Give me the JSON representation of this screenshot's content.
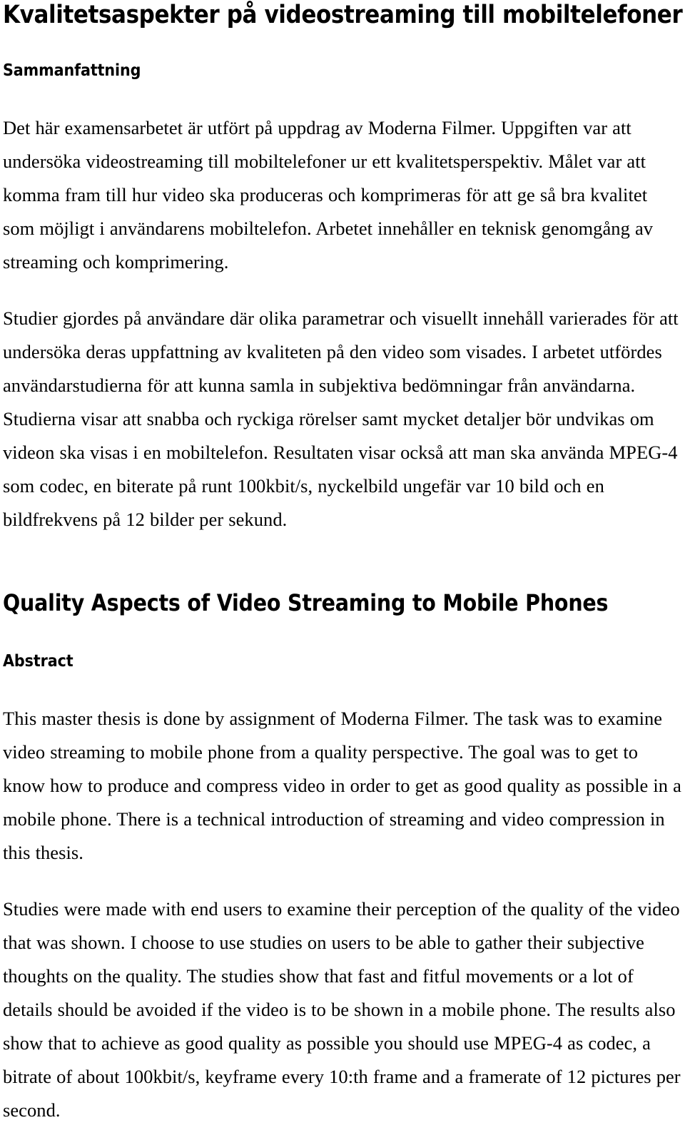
{
  "document": {
    "language_primary": "sv",
    "background_color": "#ffffff",
    "text_color": "#000000"
  },
  "swedish": {
    "title": "Kvalitetsaspekter på videostreaming till mobiltelefoner",
    "section_heading": "Sammanfattning",
    "paragraphs": [
      "Det här examensarbetet är utfört på uppdrag av Moderna Filmer. Uppgiften var att undersöka videostreaming till mobiltelefoner ur ett kvalitetsperspektiv. Målet var att komma fram till hur video ska produceras och komprimeras för att ge så bra kvalitet som möjligt i användarens mobiltelefon. Arbetet innehåller en teknisk genomgång av streaming och komprimering.",
      "Studier gjordes på användare där olika parametrar och visuellt innehåll varierades för att undersöka deras uppfattning av kvaliteten på den video som visades. I arbetet utfördes användarstudierna för att kunna samla in subjektiva bedömningar från användarna. Studierna visar att snabba och ryckiga rörelser samt mycket detaljer bör undvikas om videon ska visas i en mobiltelefon. Resultaten visar också att man ska använda MPEG-4 som codec, en biterate på runt 100kbit/s, nyckelbild ungefär var 10 bild och en bildfrekvens på 12 bilder per sekund."
    ]
  },
  "english": {
    "title": "Quality Aspects of Video Streaming to Mobile Phones",
    "section_heading": "Abstract",
    "paragraphs": [
      "This master thesis is done by assignment of Moderna Filmer. The task was to examine video streaming to mobile phone from a quality perspective. The goal was to get to know how to produce and compress video in order to get as good quality as possible in a mobile phone. There is a technical introduction of streaming and video compression in this thesis.",
      "Studies were made with end users to examine their perception of the quality of the video that was shown. I choose to use studies on users to be able to gather their subjective thoughts on the quality. The studies show that fast and fitful movements or a lot of details should be avoided if the video is to be shown in a mobile phone. The results also show that to achieve as good quality as possible you should use MPEG-4 as codec, a bitrate of about 100kbit/s, keyframe every 10:th frame and a framerate of 12 pictures per second."
    ]
  }
}
